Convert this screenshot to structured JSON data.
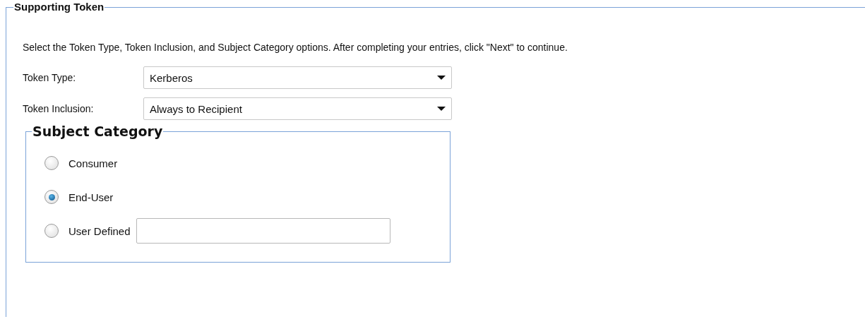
{
  "panel": {
    "title": "Supporting Token",
    "instructions": "Select the Token Type, Token Inclusion, and Subject Category options. After completing your entries, click \"Next\" to continue.",
    "fields": [
      {
        "label": "Token Type:",
        "value": "Kerberos"
      },
      {
        "label": "Token Inclusion:",
        "value": "Always to Recipient"
      }
    ],
    "subject_category": {
      "title": "Subject Category",
      "options": [
        {
          "label": "Consumer",
          "selected": false
        },
        {
          "label": "End-User",
          "selected": true
        },
        {
          "label": "User Defined",
          "selected": false,
          "kind": "text-entry"
        }
      ]
    }
  }
}
